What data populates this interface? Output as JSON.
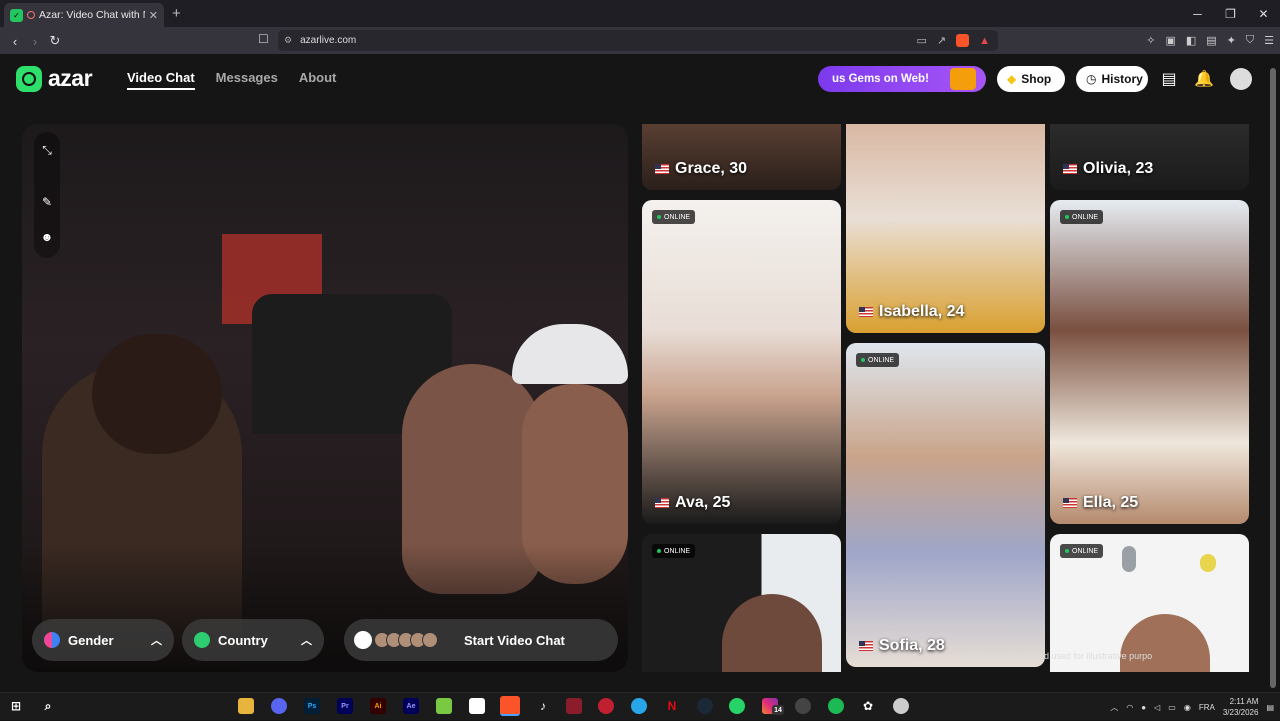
{
  "browser": {
    "tab_title": "Azar: Video Chat with New P",
    "url": "azarlive.com",
    "new_tab": "+",
    "minimize": "─",
    "maximize": "❐",
    "close": "✕"
  },
  "site": {
    "logo": "azar",
    "nav": [
      "Video Chat",
      "Messages",
      "About"
    ],
    "gems_banner": "us Gems on Web!",
    "shop": "Shop",
    "history": "History"
  },
  "video": {
    "gender": "Gender",
    "country": "Country",
    "start": "Start Video Chat"
  },
  "profiles": [
    {
      "name": "Grace, 30",
      "online": false
    },
    {
      "name": "Isabella, 24",
      "online": false
    },
    {
      "name": "Olivia, 23",
      "online": false
    },
    {
      "name": "Ava, 25",
      "online": true
    },
    {
      "name": "Sofia, 28",
      "online": true
    },
    {
      "name": "Ella, 25",
      "online": true
    },
    {
      "name": "",
      "online": true
    },
    {
      "name": "",
      "online": true
    }
  ],
  "online_label": "ONLINE",
  "disclaimer": "All images are of mod        used for illustrative purpo",
  "taskbar": {
    "lang": "FRA",
    "time": "2:11 AM",
    "date": "3/23/2026",
    "insta_badge": "14"
  },
  "colors": {
    "accent_green": "#2ee06b",
    "gems_purple": "#8b3cf0",
    "online_dot": "#22c55e"
  }
}
